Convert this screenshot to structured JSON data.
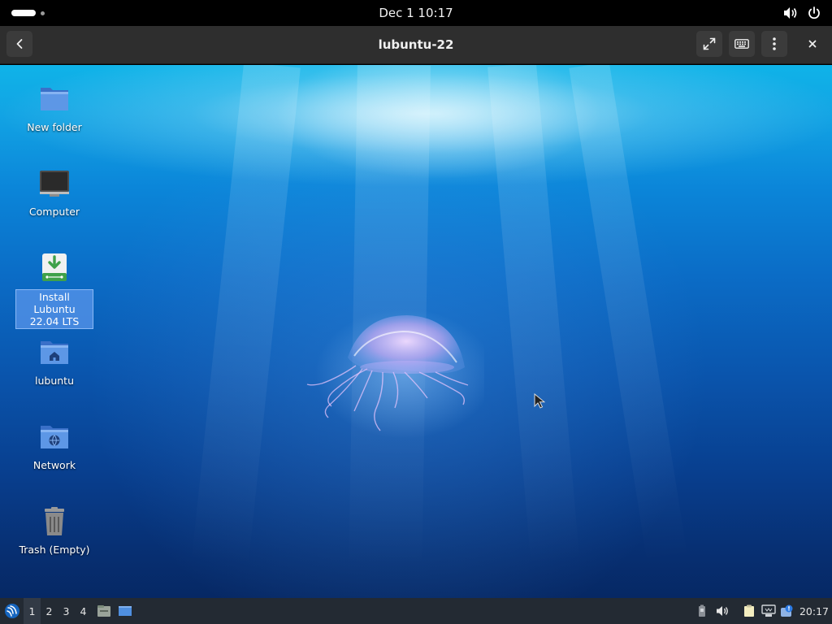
{
  "top_bar": {
    "clock": "Dec 1  10:17",
    "icons": [
      "volume-icon",
      "power-icon"
    ]
  },
  "header": {
    "title": "lubuntu-22",
    "buttons": [
      "back-icon",
      "fullscreen-icon",
      "keyboard-icon",
      "kebab-menu-icon",
      "close-icon"
    ]
  },
  "desktop": {
    "icons": [
      {
        "label": "New folder",
        "icon": "folder-icon"
      },
      {
        "label": "Computer",
        "icon": "computer-icon"
      },
      {
        "label": "Install Lubuntu 22.04 LTS",
        "icon": "installer-icon",
        "selected": true
      },
      {
        "label": "lubuntu",
        "icon": "home-folder-icon"
      },
      {
        "label": "Network",
        "icon": "network-icon"
      },
      {
        "label": "Trash (Empty)",
        "icon": "trash-icon"
      }
    ]
  },
  "taskbar": {
    "workspaces": [
      "1",
      "2",
      "3",
      "4"
    ],
    "active_workspace": "1",
    "clock": "20:17",
    "tray_icons": [
      "battery-icon",
      "volume-icon",
      "clipboard-icon",
      "network-icon",
      "update-notifier-icon"
    ]
  },
  "colors": {
    "panel": "#000000",
    "header": "#2e2e2e",
    "taskbar": "#232a33",
    "selection": "#5a96eb"
  }
}
